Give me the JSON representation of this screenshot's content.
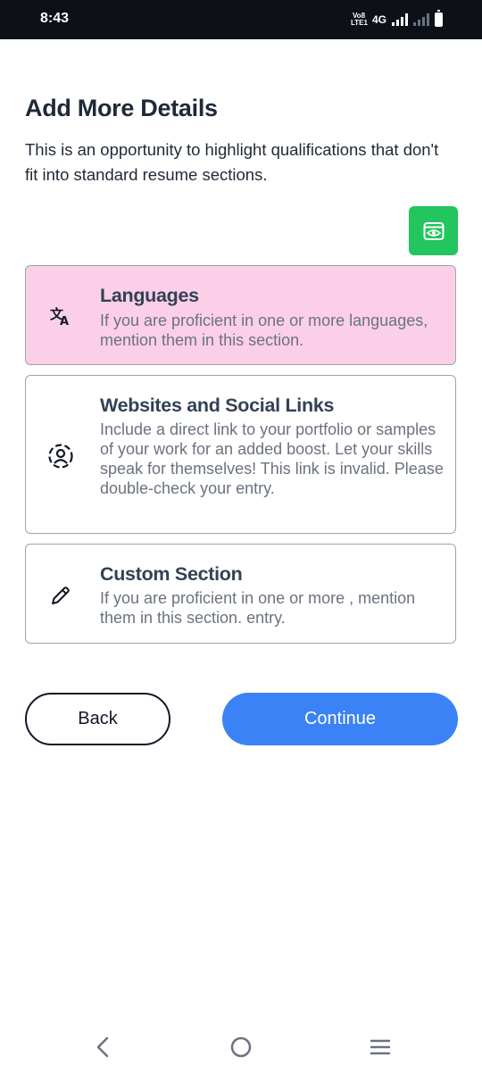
{
  "status_bar": {
    "time": "8:43",
    "volte_line1": "Vo8",
    "volte_line2": "LTE1",
    "network": "4G"
  },
  "header": {
    "title": "Add More Details",
    "description": "This is an opportunity to highlight qualifications that don't fit into standard resume sections."
  },
  "preview_button": {
    "icon": "eye-icon",
    "color": "#22c55e"
  },
  "sections": [
    {
      "icon": "translate-icon",
      "title": "Languages",
      "description": "If you are proficient in one or more languages, mention them in this section.",
      "active": true
    },
    {
      "icon": "user-scan-icon",
      "title": "Websites and Social Links",
      "description": "Include a direct link to your portfolio or samples of your work for an added boost. Let your skills speak for themselves! This link is invalid. Please double-check your entry.",
      "active": false
    },
    {
      "icon": "pencil-icon",
      "title": "Custom Section",
      "description": "If you are proficient in one or more , mention them in this section. entry.",
      "active": false
    }
  ],
  "actions": {
    "back_label": "Back",
    "continue_label": "Continue",
    "accent_color": "#3b82f6",
    "active_card_color": "#fbcfe8"
  },
  "system_nav": {
    "back": "back-icon",
    "home": "home-icon",
    "recents": "recents-icon"
  }
}
